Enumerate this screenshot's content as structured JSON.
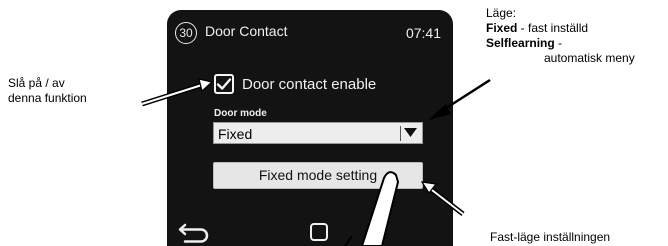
{
  "screen": {
    "badge_number": "30",
    "title": "Door Contact",
    "time": "07:41",
    "checkbox_label": "Door contact enable",
    "checkbox_checked": true,
    "door_mode_label": "Door mode",
    "door_mode_value": "Fixed",
    "fixed_mode_button": "Fixed mode setting"
  },
  "annotations": {
    "left_line1": "Slå på / av",
    "left_line2": "denna funktion",
    "top_heading": "Läge:",
    "fixed_bold": "Fixed",
    "fixed_desc": " - fast inställd",
    "selflearning_bold": "Selflearning",
    "selflearning_dash": " -",
    "selflearning_desc": "automatisk meny",
    "bottom_right": "Fast-läge inställningen"
  }
}
